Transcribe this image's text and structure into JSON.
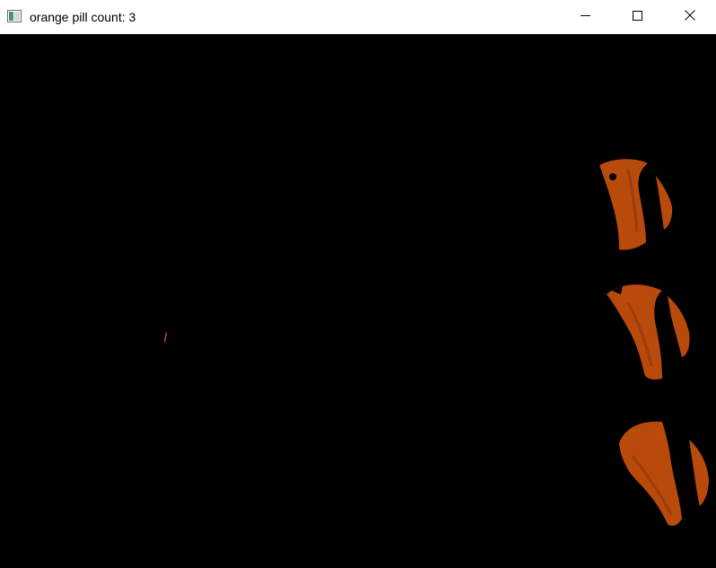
{
  "window": {
    "title": "orange pill count: 3",
    "app_icon": "opencv-window-icon",
    "controls": {
      "minimize_icon": "minimize-icon",
      "maximize_icon": "maximize-icon",
      "close_icon": "close-icon"
    }
  },
  "image": {
    "background_color": "#000000",
    "blob_color": "#b84a0c",
    "blob_shadow_color": "#8a3508",
    "detected_pill_count": 3
  }
}
